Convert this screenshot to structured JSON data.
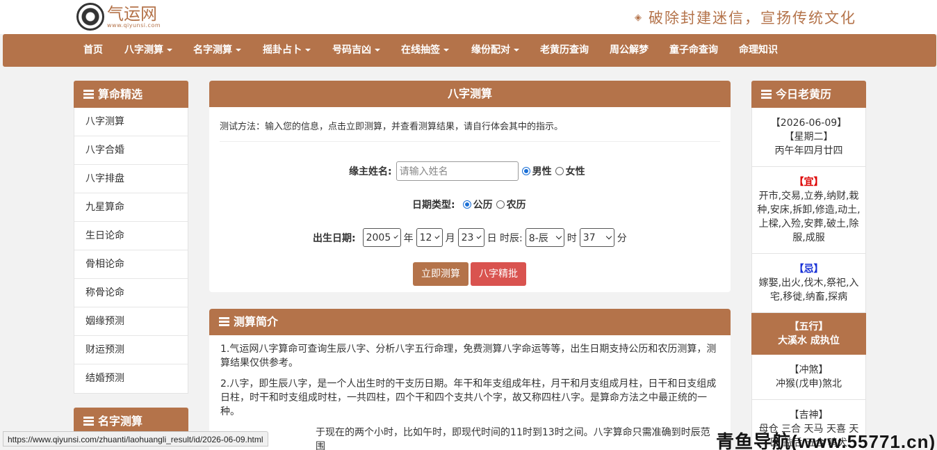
{
  "header": {
    "logo_name": "气运网",
    "logo_url": "www.qiyunsi.com",
    "slogan": "破除封建迷信，宣扬传统文化"
  },
  "nav": [
    {
      "label": "首页",
      "dropdown": false
    },
    {
      "label": "八字测算",
      "dropdown": true
    },
    {
      "label": "名字测算",
      "dropdown": true
    },
    {
      "label": "摇卦占卜",
      "dropdown": true
    },
    {
      "label": "号码吉凶",
      "dropdown": true
    },
    {
      "label": "在线抽签",
      "dropdown": true
    },
    {
      "label": "缘份配对",
      "dropdown": true
    },
    {
      "label": "老黄历查询",
      "dropdown": false
    },
    {
      "label": "周公解梦",
      "dropdown": false
    },
    {
      "label": "童子命查询",
      "dropdown": false
    },
    {
      "label": "命理知识",
      "dropdown": false
    }
  ],
  "left_panel": {
    "title": "算命精选",
    "items": [
      "八字测算",
      "八字合婚",
      "八字排盘",
      "九星算命",
      "生日论命",
      "骨相论命",
      "称骨论命",
      "姻缘预测",
      "财运预测",
      "结婚预测"
    ]
  },
  "left_panel2": {
    "title": "名字测算"
  },
  "form_card": {
    "title": "八字测算",
    "method": "测试方法：输入您的信息，点击立即测算，并查看测算结果，请自行体会其中的指示。",
    "name_label": "缘主姓名:",
    "name_placeholder": "请输入姓名",
    "gender_male": "男性",
    "gender_female": "女性",
    "date_type_label": "日期类型:",
    "date_solar": "公历",
    "date_lunar": "农历",
    "birth_label": "出生日期:",
    "year": "2005",
    "year_unit": "年",
    "month": "12",
    "month_unit": "月",
    "day": "23",
    "day_unit": "日 时辰:",
    "hour": "8-辰",
    "hour_unit": "时",
    "minute": "37",
    "minute_unit": "分",
    "submit": "立即测算",
    "premium": "八字精批"
  },
  "intro": {
    "title": "测算简介",
    "p1": "1.气运网八字算命可查询生辰八字、分析八字五行命理，免费测算八字命运等等，出生日期支持公历和农历测算，测算结果仅供参考。",
    "p2": "2.八字，即生辰八字，是一个人出生时的干支历日期。年干和年支组成年柱，月干和月支组成月柱，日干和日支组成日柱，时干和时支组成时柱，一共四柱，四个干和四个支共八个字，故又称四柱八字。是算命方法之中最正统的一种。",
    "p3": "于现在的两个小时，比如午时，即现代时间的11时到13时之间。八字算命只需准确到时辰范围"
  },
  "almanac": {
    "title": "今日老黄历",
    "date": "【2026-06-09】",
    "weekday": "【星期二】",
    "lunar": "丙午年四月廿四",
    "yi_label": "【宜】",
    "yi": "开市,交易,立券,纳财,栽种,安床,拆卸,修造,动土,上樑,入殓,安葬,破土,除服,成服",
    "ji_label": "【忌】",
    "ji": "嫁娶,出火,伐木,祭祀,入宅,移徙,纳畜,探病",
    "wuxing_label": "【五行】",
    "wuxing": "大溪水 成执位",
    "chongsha_label": "【冲煞】",
    "chongsha": "冲猴(戊申)煞北",
    "jishen_label": "【吉神】",
    "jishen": "母仓 三合 天马 天喜 天医 益后 五合 鸣犬"
  },
  "status_url": "https://www.qiyunsi.com/zhuanti/laohuangli_result/id/2026-06-09.html",
  "watermark": "青鱼导航(www.55771.cn)",
  "colors": {
    "brand": "#b4734a",
    "danger": "#d9534f",
    "radio": "#1a6fd6"
  }
}
